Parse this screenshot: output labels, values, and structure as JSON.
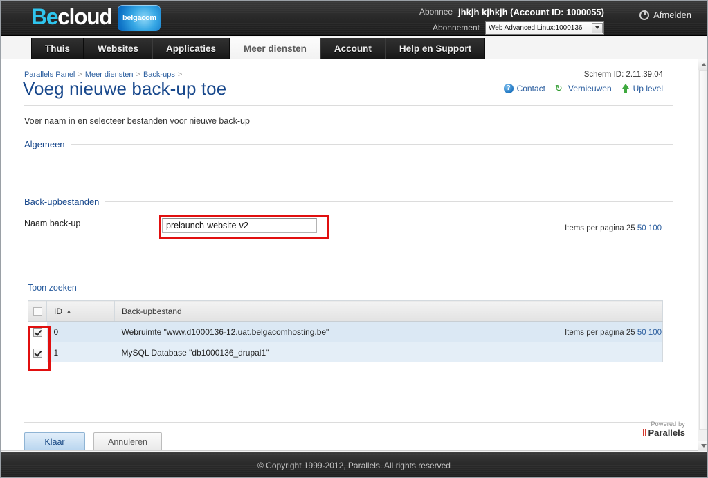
{
  "header": {
    "logo_be": "Be",
    "logo_cloud": "cloud",
    "logo_badge": "belgacom",
    "subscriber_label": "Abonnee",
    "subscriber_value": "jhkjh kjhkjh (Account ID: 1000055)",
    "subscription_label": "Abonnement",
    "subscription_value": "Web Advanced Linux:1000136",
    "logout_label": "Afmelden"
  },
  "tabs": [
    {
      "label": "Thuis",
      "active": false
    },
    {
      "label": "Websites",
      "active": false
    },
    {
      "label": "Applicaties",
      "active": false
    },
    {
      "label": "Meer diensten",
      "active": true
    },
    {
      "label": "Account",
      "active": false
    },
    {
      "label": "Help en Support",
      "active": false
    }
  ],
  "breadcrumb": {
    "items": [
      "Parallels Panel",
      "Meer diensten",
      "Back-ups"
    ],
    "separator": ">"
  },
  "page": {
    "title": "Voeg nieuwe back-up toe",
    "subtitle": "Voer naam in en selecteer bestanden voor nieuwe back-up",
    "screen_id_label": "Scherm ID:",
    "screen_id_value": "2.11.39.04"
  },
  "util_links": [
    {
      "label": "Contact",
      "icon": "help-circle-icon"
    },
    {
      "label": "Vernieuwen",
      "icon": "refresh-icon"
    },
    {
      "label": "Up level",
      "icon": "up-level-icon"
    }
  ],
  "sections": {
    "general": "Algemeen",
    "backup_files": "Back-upbestanden"
  },
  "form": {
    "backup_name_label": "Naam back-up",
    "backup_name_value": "prelaunch-website-v2",
    "backup_name_placeholder": ""
  },
  "table_toolbar": {
    "show_search": "Toon zoeken",
    "items_per_page_label": "Items per pagina",
    "items_per_page_options": [
      "25",
      "50",
      "100"
    ],
    "items_per_page_selected": "25"
  },
  "table": {
    "columns": [
      "",
      "ID",
      "Back-upbestand"
    ],
    "sort_column": "ID",
    "sort_direction": "asc",
    "sort_glyph": "▲",
    "header_checkbox_checked": false,
    "rows": [
      {
        "checked": true,
        "id": "0",
        "file": "Webruimte \"www.d1000136-12.uat.belgacomhosting.be\""
      },
      {
        "checked": true,
        "id": "1",
        "file": "MySQL Database \"db1000136_drupal1\""
      }
    ]
  },
  "buttons": {
    "ok": "Klaar",
    "cancel": "Annuleren"
  },
  "powered": {
    "prefix": "Powered by",
    "brand": "Parallels"
  },
  "footer": {
    "copyright": "© Copyright 1999-2012, Parallels. All rights reserved"
  },
  "highlight_color": "#e10f0f"
}
